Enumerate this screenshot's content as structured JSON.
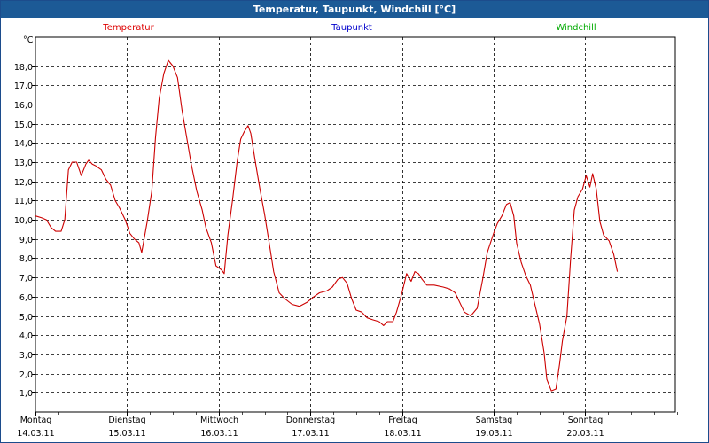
{
  "window": {
    "title": "Temperatur, Taupunkt, Windchill [°C]"
  },
  "chart_data": {
    "type": "line",
    "title": "Temperatur, Taupunkt, Windchill [°C]",
    "ylabel": "°C",
    "ylim": [
      0,
      19.5
    ],
    "yticks": [
      "1,0",
      "2,0",
      "3,0",
      "4,0",
      "5,0",
      "6,0",
      "7,0",
      "8,0",
      "9,0",
      "10,0",
      "11,0",
      "12,0",
      "13,0",
      "14,0",
      "15,0",
      "16,0",
      "17,0",
      "18,0"
    ],
    "xlim": [
      0,
      7
    ],
    "days": [
      {
        "weekday": "Montag",
        "date": "14.03.11"
      },
      {
        "weekday": "Dienstag",
        "date": "15.03.11"
      },
      {
        "weekday": "Mittwoch",
        "date": "16.03.11"
      },
      {
        "weekday": "Donnerstag",
        "date": "17.03.11"
      },
      {
        "weekday": "Freitag",
        "date": "18.03.11"
      },
      {
        "weekday": "Samstag",
        "date": "19.03.11"
      },
      {
        "weekday": "Sonntag",
        "date": "20.03.11"
      }
    ],
    "grid": true,
    "legend": [
      {
        "name": "Temperatur",
        "color": "#dd0000"
      },
      {
        "name": "Taupunkt",
        "color": "#0000cc"
      },
      {
        "name": "Windchill",
        "color": "#00aa00"
      }
    ],
    "series": [
      {
        "name": "Temperatur",
        "color": "#cc0000",
        "points": [
          [
            0.0,
            10.2
          ],
          [
            0.07,
            10.1
          ],
          [
            0.12,
            10.0
          ],
          [
            0.17,
            9.6
          ],
          [
            0.22,
            9.4
          ],
          [
            0.28,
            9.4
          ],
          [
            0.32,
            10.0
          ],
          [
            0.36,
            12.6
          ],
          [
            0.4,
            13.0
          ],
          [
            0.45,
            13.0
          ],
          [
            0.5,
            12.3
          ],
          [
            0.55,
            12.9
          ],
          [
            0.58,
            13.1
          ],
          [
            0.62,
            12.9
          ],
          [
            0.66,
            12.8
          ],
          [
            0.72,
            12.6
          ],
          [
            0.77,
            12.1
          ],
          [
            0.82,
            11.8
          ],
          [
            0.87,
            11.0
          ],
          [
            0.92,
            10.6
          ],
          [
            0.98,
            10.0
          ],
          [
            1.03,
            9.3
          ],
          [
            1.08,
            9.0
          ],
          [
            1.13,
            8.8
          ],
          [
            1.16,
            8.3
          ],
          [
            1.22,
            9.9
          ],
          [
            1.27,
            11.5
          ],
          [
            1.31,
            14.3
          ],
          [
            1.35,
            16.3
          ],
          [
            1.4,
            17.6
          ],
          [
            1.45,
            18.3
          ],
          [
            1.5,
            18.0
          ],
          [
            1.55,
            17.4
          ],
          [
            1.6,
            15.7
          ],
          [
            1.65,
            14.3
          ],
          [
            1.7,
            12.9
          ],
          [
            1.76,
            11.5
          ],
          [
            1.82,
            10.5
          ],
          [
            1.86,
            9.6
          ],
          [
            1.92,
            8.8
          ],
          [
            1.97,
            7.6
          ],
          [
            2.03,
            7.4
          ],
          [
            2.06,
            7.2
          ],
          [
            2.1,
            9.2
          ],
          [
            2.15,
            11.0
          ],
          [
            2.2,
            13.0
          ],
          [
            2.24,
            14.2
          ],
          [
            2.28,
            14.6
          ],
          [
            2.32,
            14.9
          ],
          [
            2.35,
            14.5
          ],
          [
            2.4,
            13.0
          ],
          [
            2.45,
            11.6
          ],
          [
            2.5,
            10.3
          ],
          [
            2.55,
            8.8
          ],
          [
            2.6,
            7.3
          ],
          [
            2.66,
            6.2
          ],
          [
            2.72,
            5.9
          ],
          [
            2.8,
            5.6
          ],
          [
            2.88,
            5.5
          ],
          [
            2.96,
            5.7
          ],
          [
            3.04,
            6.0
          ],
          [
            3.1,
            6.2
          ],
          [
            3.18,
            6.3
          ],
          [
            3.24,
            6.5
          ],
          [
            3.3,
            6.9
          ],
          [
            3.35,
            7.0
          ],
          [
            3.4,
            6.7
          ],
          [
            3.45,
            5.9
          ],
          [
            3.5,
            5.3
          ],
          [
            3.56,
            5.2
          ],
          [
            3.62,
            4.9
          ],
          [
            3.68,
            4.8
          ],
          [
            3.75,
            4.7
          ],
          [
            3.8,
            4.5
          ],
          [
            3.84,
            4.7
          ],
          [
            3.9,
            4.7
          ],
          [
            3.94,
            5.2
          ],
          [
            4.0,
            6.2
          ],
          [
            4.05,
            7.2
          ],
          [
            4.1,
            6.8
          ],
          [
            4.14,
            7.3
          ],
          [
            4.18,
            7.2
          ],
          [
            4.22,
            6.9
          ],
          [
            4.27,
            6.6
          ],
          [
            4.35,
            6.6
          ],
          [
            4.45,
            6.5
          ],
          [
            4.52,
            6.4
          ],
          [
            4.58,
            6.2
          ],
          [
            4.62,
            5.8
          ],
          [
            4.68,
            5.2
          ],
          [
            4.75,
            5.0
          ],
          [
            4.82,
            5.4
          ],
          [
            4.88,
            6.9
          ],
          [
            4.93,
            8.3
          ],
          [
            5.0,
            9.3
          ],
          [
            5.04,
            9.8
          ],
          [
            5.09,
            10.2
          ],
          [
            5.14,
            10.8
          ],
          [
            5.18,
            10.9
          ],
          [
            5.22,
            10.2
          ],
          [
            5.25,
            8.8
          ],
          [
            5.3,
            7.8
          ],
          [
            5.35,
            7.1
          ],
          [
            5.4,
            6.6
          ],
          [
            5.45,
            5.6
          ],
          [
            5.5,
            4.6
          ],
          [
            5.55,
            3.1
          ],
          [
            5.58,
            1.7
          ],
          [
            5.63,
            1.1
          ],
          [
            5.68,
            1.2
          ],
          [
            5.72,
            2.5
          ],
          [
            5.75,
            3.7
          ],
          [
            5.8,
            5.0
          ],
          [
            5.84,
            8.0
          ],
          [
            5.88,
            10.5
          ],
          [
            5.92,
            11.2
          ],
          [
            5.97,
            11.6
          ],
          [
            6.01,
            12.3
          ],
          [
            6.05,
            11.7
          ],
          [
            6.08,
            12.4
          ],
          [
            6.12,
            11.6
          ],
          [
            6.16,
            9.9
          ],
          [
            6.2,
            9.2
          ],
          [
            6.26,
            8.9
          ],
          [
            6.31,
            8.2
          ],
          [
            6.35,
            7.3
          ]
        ]
      }
    ]
  }
}
